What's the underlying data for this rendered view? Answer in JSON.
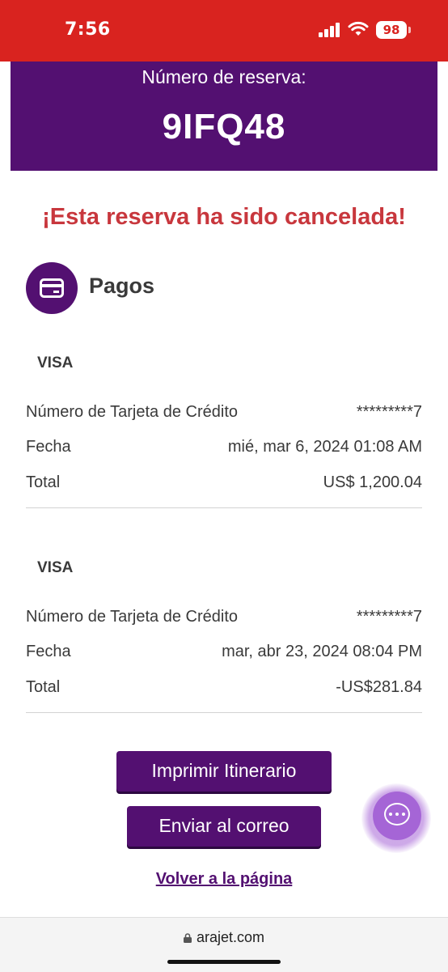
{
  "status_bar": {
    "time": "7:56",
    "battery": "98"
  },
  "reservation": {
    "label": "Número de reserva:",
    "code": "9IFQ48"
  },
  "notice": "¡Esta reserva ha sido cancelada!",
  "pagos": {
    "title": "Pagos",
    "payments": [
      {
        "card_type": "VISA",
        "card_number_label": "Número de Tarjeta de Crédito",
        "card_number": "*********7",
        "date_label": "Fecha",
        "date": "mié, mar 6, 2024 01:08 AM",
        "total_label": "Total",
        "total": "US$ 1,200.04"
      },
      {
        "card_type": "VISA",
        "card_number_label": "Número de Tarjeta de Crédito",
        "card_number": "*********7",
        "date_label": "Fecha",
        "date": "mar, abr 23, 2024 08:04 PM",
        "total_label": "Total",
        "total": "-US$281.84"
      }
    ]
  },
  "actions": {
    "print_label": "Imprimir Itinerario",
    "email_label": "Enviar al correo",
    "back_label": "Volver a la página"
  },
  "browser": {
    "url": "arajet.com"
  },
  "colors": {
    "brand_purple": "#531071",
    "status_red": "#d9231f",
    "cancel_red": "#c8373d",
    "chat_purple": "#a565d6"
  },
  "icons": [
    "credit-card-icon",
    "chat-icon",
    "lock-icon",
    "signal-icon",
    "wifi-icon",
    "battery-icon"
  ]
}
